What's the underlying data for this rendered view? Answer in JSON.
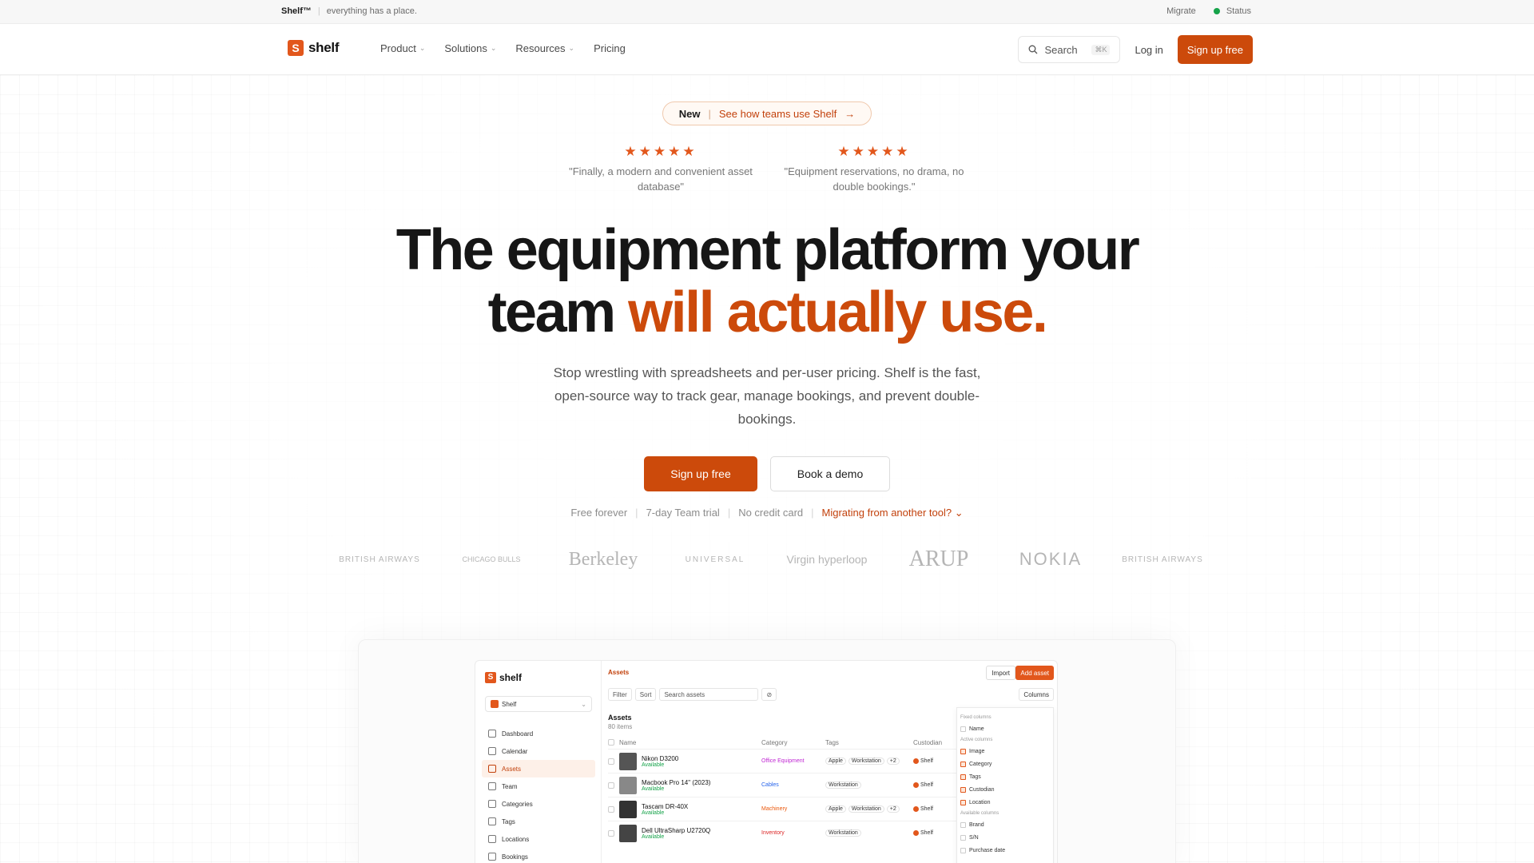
{
  "topbar": {
    "brand": "Shelf™",
    "tagline": "everything has a place.",
    "links": [
      "Migrate",
      "Status"
    ],
    "status_color": "#16a34a"
  },
  "nav": {
    "logo_letter": "S",
    "logo_text": "shelf",
    "menu": [
      "Product",
      "Solutions",
      "Resources",
      "Pricing"
    ],
    "search_label": "Search",
    "search_shortcut": "⌘K",
    "login": "Log in",
    "signup": "Sign up free"
  },
  "announcement": {
    "badge": "New",
    "link": "See how teams use Shelf"
  },
  "reviews": [
    {
      "stars": "★★★★★",
      "quote": "\"Finally, a modern and convenient asset database\""
    },
    {
      "stars": "★★★★★",
      "quote": "\"Equipment reservations, no drama, no double bookings.\""
    }
  ],
  "hero": {
    "headline_line1": "The equipment platform your",
    "headline_line2_plain": "team ",
    "headline_line2_accent": "will actually use.",
    "subtext": "Stop wrestling with spreadsheets and per-user pricing. Shelf is the fast, open-source way to track gear, manage bookings, and prevent double-bookings.",
    "primary_cta": "Sign up free",
    "secondary_cta": "Book a demo"
  },
  "fine_print": {
    "items": [
      "Free forever",
      "7-day Team trial",
      "No credit card"
    ],
    "migrate": "Migrating from another tool?"
  },
  "customer_logos": [
    "BRITISH AIRWAYS",
    "CHICAGO BULLS",
    "Berkeley",
    "UNIVERSAL",
    "Virgin hyperloop",
    "ARUP",
    "NOKIA",
    "BRITISH AIRWAYS"
  ],
  "colors": {
    "accent": "#cc4a0b",
    "brand": "#e2571c"
  },
  "app_preview": {
    "logo_text": "shelf",
    "workspace": "Shelf",
    "sidebar": [
      "Dashboard",
      "Calendar",
      "Assets",
      "Team",
      "Categories",
      "Tags",
      "Locations",
      "Bookings"
    ],
    "active_item": "Assets",
    "breadcrumb": "Assets",
    "import_label": "Import",
    "add_label": "Add asset",
    "toolbar": [
      "Filter",
      "Sort",
      "Search assets"
    ],
    "columns_label": "Columns",
    "list_title": "Assets",
    "list_count": "80 items",
    "table_headers": [
      "Name",
      "Category",
      "Tags",
      "Custodian"
    ],
    "rows": [
      {
        "name": "Nikon D3200",
        "status": "Available",
        "category": "Office Equipment",
        "tags": [
          "Apple",
          "Workstation",
          "+2"
        ],
        "custodian": "Shelf"
      },
      {
        "name": "Macbook Pro 14\" (2023)",
        "status": "Available",
        "category": "Cables",
        "tags": [
          "Workstation"
        ],
        "custodian": "Shelf"
      },
      {
        "name": "Tascam DR-40X",
        "status": "Available",
        "category": "Machinery",
        "tags": [
          "Apple",
          "Workstation",
          "+2"
        ],
        "custodian": "Shelf"
      },
      {
        "name": "Dell UltraSharp U2720Q",
        "status": "Available",
        "category": "Inventory",
        "tags": [
          "Workstation"
        ],
        "custodian": "Shelf"
      }
    ],
    "columns_panel": {
      "fixed_heading": "Fixed columns",
      "fixed": [
        "Name"
      ],
      "active_heading": "Active columns",
      "active": [
        "Image",
        "Category",
        "Tags",
        "Custodian",
        "Location"
      ],
      "available_heading": "Available columns",
      "available": [
        "Brand",
        "S/N",
        "Purchase date"
      ]
    }
  }
}
